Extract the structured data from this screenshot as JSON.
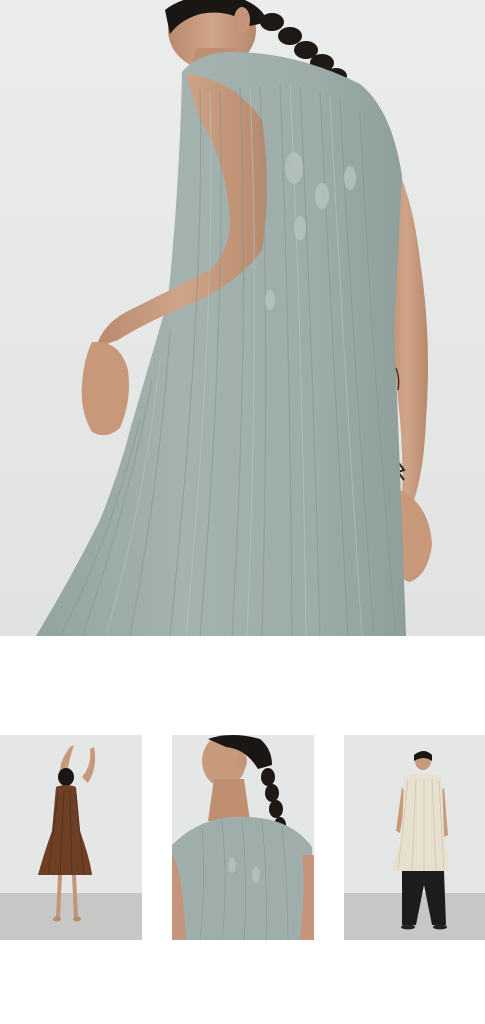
{
  "gallery": {
    "main_image": {
      "subject": "model-back-view-pleated-sage-dress"
    },
    "thumbnails": [
      {
        "subject": "brown-pleated-dress-full-length"
      },
      {
        "subject": "sage-dress-back-closeup"
      },
      {
        "subject": "cream-pleated-tunic-black-trousers"
      }
    ]
  },
  "colors": {
    "background": "#ffffff",
    "wall": "#e6e7e7",
    "floor": "#c9c9c8",
    "dress_sage": "#9faeaa",
    "dress_brown": "#6e3f24",
    "tunic_cream": "#e8e0cf",
    "trousers_black": "#1d1c1b",
    "skin": "#c89a7c",
    "hair": "#1a1613"
  }
}
